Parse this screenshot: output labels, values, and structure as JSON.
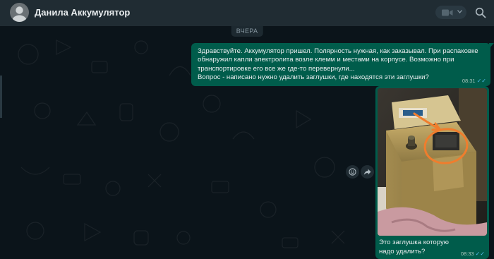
{
  "header": {
    "contact_name": "Данила Аккумулятор",
    "avatar_icon": "person-icon",
    "video_icon": "video-call-icon",
    "search_icon": "search-icon"
  },
  "chat": {
    "date_separator": "ВЧЕРА",
    "messages": [
      {
        "direction": "outgoing",
        "lines": [
          "Здравствуйте. Аккумулятор пришел. Полярность нужная, как заказывал. При распаковке",
          "обнаружил капли электролита возле клемм и местами на корпусе. Возможно при",
          "транспортировке его все же где-то перевернули...",
          "Вопрос - написано нужно удалить заглушки, где находятся эти заглушки?"
        ],
        "time": "08:31",
        "status": "read"
      },
      {
        "direction": "outgoing",
        "type": "image",
        "image_description": "photo-battery-with-orange-circle",
        "caption": "Это заглушка которую надо удалить?",
        "time": "08:33",
        "status": "read"
      }
    ],
    "actions": [
      "emoji-reaction-icon",
      "forward-icon"
    ]
  },
  "colors": {
    "background": "#0b141a",
    "header": "#202c33",
    "outgoing_bubble": "#005c4b",
    "read_ticks": "#53bdeb",
    "annotation": "#f07d2d"
  }
}
